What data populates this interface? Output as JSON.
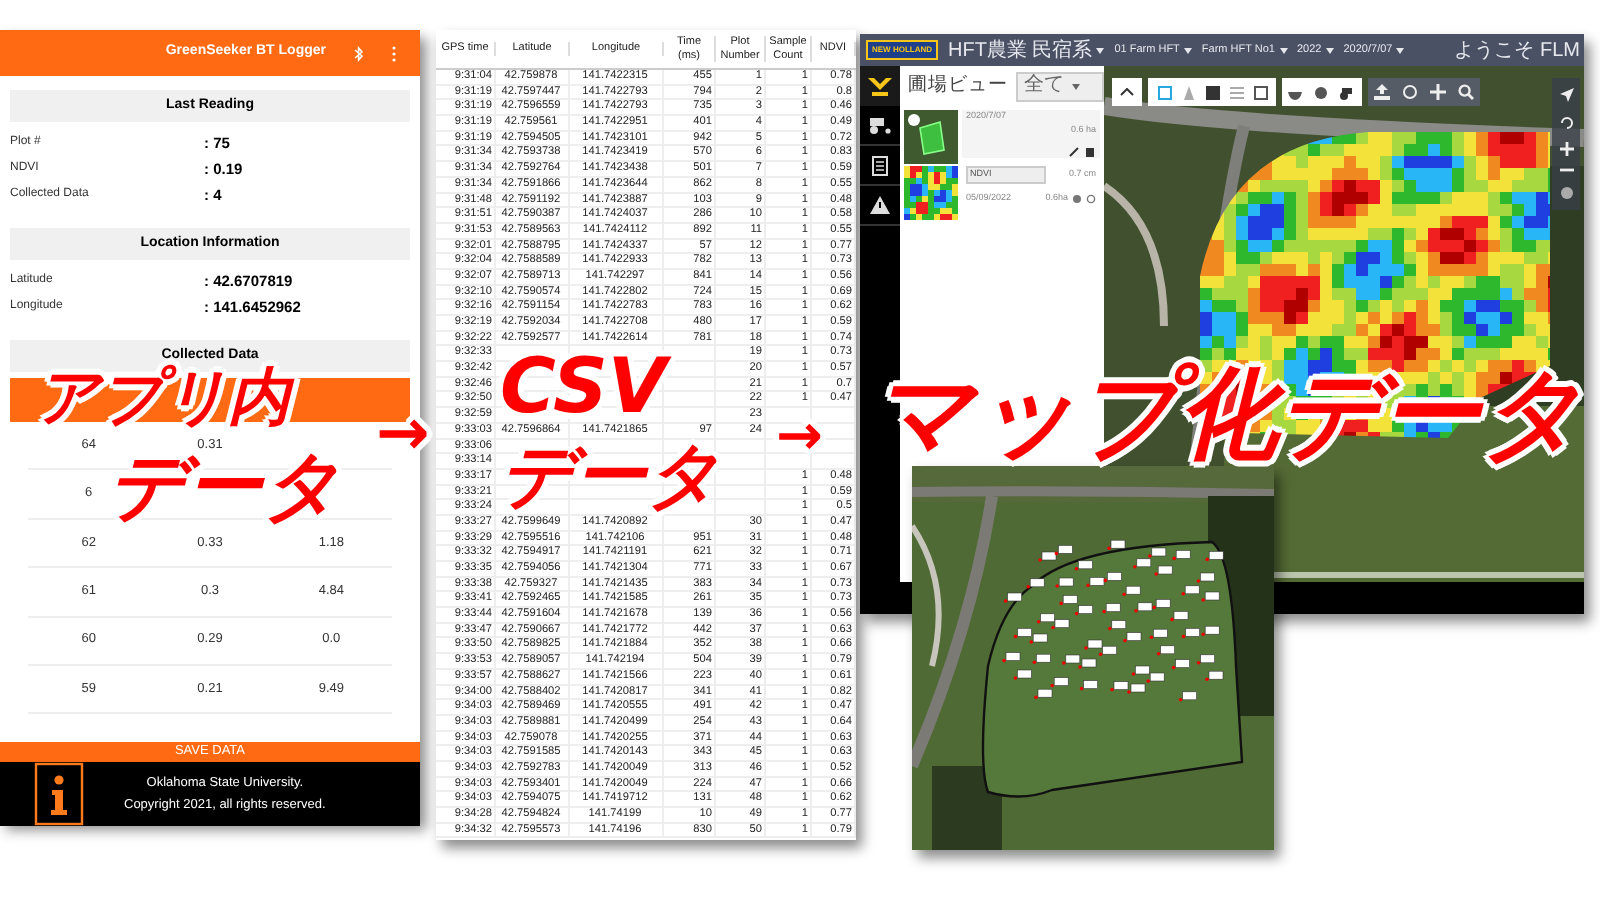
{
  "phone_app": {
    "title": "GreenSeeker BT Logger",
    "sections": [
      {
        "heading": "Last Reading",
        "fields": [
          {
            "label": "Plot #",
            "value": ": 75"
          },
          {
            "label": "NDVI",
            "value": ": 0.19"
          },
          {
            "label": "Collected Data",
            "value": ": 4"
          }
        ]
      },
      {
        "heading": "Location Information",
        "fields": [
          {
            "label": "Latitude",
            "value": ": 42.6707819"
          },
          {
            "label": "Longitude",
            "value": ": 141.6452962"
          }
        ]
      }
    ],
    "collected_data": {
      "heading": "Collected Data",
      "rows": [
        [
          "64",
          "0.31",
          null
        ],
        [
          "6",
          null,
          null
        ],
        [
          "62",
          "0.33",
          "1.18"
        ],
        [
          "61",
          "0.3",
          "4.84"
        ],
        [
          "60",
          "0.29",
          "0.0"
        ],
        [
          "59",
          "0.21",
          "9.49"
        ]
      ]
    },
    "save_button": "SAVE DATA",
    "footer_lines": [
      "Oklahoma State University.",
      "Copyright 2021, all rights reserved."
    ]
  },
  "csv_table": {
    "columns": [
      "GPS time",
      "Latitude",
      "Longitude",
      "Time (ms)",
      "Plot Number",
      "Sample Count",
      "NDVI"
    ],
    "rows": [
      [
        "9:31:04",
        "42.759878",
        "141.7422315",
        "455",
        "1",
        "1",
        "0.78"
      ],
      [
        "9:31:19",
        "42.7597447",
        "141.7422793",
        "794",
        "2",
        "1",
        "0.8"
      ],
      [
        "9:31:19",
        "42.7596559",
        "141.7422793",
        "735",
        "3",
        "1",
        "0.46"
      ],
      [
        "9:31:19",
        "42.759561",
        "141.7422951",
        "401",
        "4",
        "1",
        "0.49"
      ],
      [
        "9:31:19",
        "42.7594505",
        "141.7423101",
        "942",
        "5",
        "1",
        "0.72"
      ],
      [
        "9:31:34",
        "42.7593738",
        "141.7423419",
        "570",
        "6",
        "1",
        "0.83"
      ],
      [
        "9:31:34",
        "42.7592764",
        "141.7423438",
        "501",
        "7",
        "1",
        "0.59"
      ],
      [
        "9:31:34",
        "42.7591866",
        "141.7423644",
        "862",
        "8",
        "1",
        "0.55"
      ],
      [
        "9:31:48",
        "42.7591192",
        "141.7423887",
        "103",
        "9",
        "1",
        "0.48"
      ],
      [
        "9:31:51",
        "42.7590387",
        "141.7424037",
        "286",
        "10",
        "1",
        "0.58"
      ],
      [
        "9:31:53",
        "42.7589563",
        "141.7424112",
        "892",
        "11",
        "1",
        "0.55"
      ],
      [
        "9:32:01",
        "42.7588795",
        "141.7424337",
        "57",
        "12",
        "1",
        "0.77"
      ],
      [
        "9:32:04",
        "42.7588589",
        "141.7422933",
        "782",
        "13",
        "1",
        "0.73"
      ],
      [
        "9:32:07",
        "42.7589713",
        "141.742297",
        "841",
        "14",
        "1",
        "0.56"
      ],
      [
        "9:32:10",
        "42.7590574",
        "141.7422802",
        "724",
        "15",
        "1",
        "0.69"
      ],
      [
        "9:32:16",
        "42.7591154",
        "141.7422783",
        "783",
        "16",
        "1",
        "0.62"
      ],
      [
        "9:32:19",
        "42.7592034",
        "141.7422708",
        "480",
        "17",
        "1",
        "0.59"
      ],
      [
        "9:32:22",
        "42.7592577",
        "141.7422614",
        "781",
        "18",
        "1",
        "0.74"
      ],
      [
        "9:32:33",
        null,
        null,
        null,
        "19",
        "1",
        "0.73"
      ],
      [
        "9:32:42",
        null,
        null,
        null,
        "20",
        "1",
        "0.57"
      ],
      [
        "9:32:46",
        null,
        null,
        null,
        "21",
        "1",
        "0.7"
      ],
      [
        "9:32:50",
        null,
        null,
        null,
        "22",
        "1",
        "0.47"
      ],
      [
        "9:32:59",
        null,
        null,
        null,
        "23",
        null,
        null
      ],
      [
        "9:33:03",
        "42.7596864",
        "141.7421865",
        "97",
        "24",
        null,
        null
      ],
      [
        "9:33:06",
        null,
        null,
        null,
        null,
        null,
        null
      ],
      [
        "9:33:14",
        null,
        null,
        null,
        null,
        null,
        null
      ],
      [
        "9:33:17",
        null,
        null,
        null,
        null,
        "1",
        "0.48"
      ],
      [
        "9:33:21",
        null,
        null,
        null,
        null,
        "1",
        "0.59"
      ],
      [
        "9:33:24",
        null,
        null,
        null,
        null,
        "1",
        "0.5"
      ],
      [
        "9:33:27",
        "42.7599649",
        "141.7420892",
        null,
        "30",
        "1",
        "0.47"
      ],
      [
        "9:33:29",
        "42.7595516",
        "141.742106",
        "951",
        "31",
        "1",
        "0.48"
      ],
      [
        "9:33:32",
        "42.7594917",
        "141.7421191",
        "621",
        "32",
        "1",
        "0.71"
      ],
      [
        "9:33:35",
        "42.7594056",
        "141.7421304",
        "771",
        "33",
        "1",
        "0.67"
      ],
      [
        "9:33:38",
        "42.759327",
        "141.7421435",
        "383",
        "34",
        "1",
        "0.73"
      ],
      [
        "9:33:41",
        "42.7592465",
        "141.7421585",
        "261",
        "35",
        "1",
        "0.73"
      ],
      [
        "9:33:44",
        "42.7591604",
        "141.7421678",
        "139",
        "36",
        "1",
        "0.56"
      ],
      [
        "9:33:47",
        "42.7590667",
        "141.7421772",
        "442",
        "37",
        "1",
        "0.63"
      ],
      [
        "9:33:50",
        "42.7589825",
        "141.7421884",
        "352",
        "38",
        "1",
        "0.66"
      ],
      [
        "9:33:53",
        "42.7589057",
        "141.742194",
        "504",
        "39",
        "1",
        "0.79"
      ],
      [
        "9:33:57",
        "42.7588627",
        "141.7421566",
        "223",
        "40",
        "1",
        "0.61"
      ],
      [
        "9:34:00",
        "42.7588402",
        "141.7420817",
        "341",
        "41",
        "1",
        "0.82"
      ],
      [
        "9:34:03",
        "42.7589469",
        "141.7420555",
        "491",
        "42",
        "1",
        "0.47"
      ],
      [
        "9:34:03",
        "42.7589881",
        "141.7420499",
        "254",
        "43",
        "1",
        "0.64"
      ],
      [
        "9:34:03",
        "42.759078",
        "141.7420255",
        "371",
        "44",
        "1",
        "0.63"
      ],
      [
        "9:34:03",
        "42.7591585",
        "141.7420143",
        "343",
        "45",
        "1",
        "0.63"
      ],
      [
        "9:34:03",
        "42.7592783",
        "141.7420049",
        "313",
        "46",
        "1",
        "0.52"
      ],
      [
        "9:34:03",
        "42.7593401",
        "141.7420049",
        "224",
        "47",
        "1",
        "0.66"
      ],
      [
        "9:34:03",
        "42.7594075",
        "141.7419712",
        "131",
        "48",
        "1",
        "0.62"
      ],
      [
        "9:34:28",
        "42.7594824",
        "141.74199",
        "10",
        "49",
        "1",
        "0.77"
      ],
      [
        "9:34:32",
        "42.7595573",
        "141.74196",
        "830",
        "50",
        "1",
        "0.79"
      ]
    ]
  },
  "map_app": {
    "logo": "NEW HOLLAND",
    "selectors": [
      "HFT農業 民宿系",
      "01 Farm HFT",
      "Farm HFT No1",
      "2022",
      "2020/7/07"
    ],
    "user": "ようこそ FLM",
    "panel": {
      "title": "圃場ビュー",
      "filter": "全て",
      "cards": [
        {
          "kind": "field",
          "date": "2020/7/07",
          "area": "0.6 ha"
        },
        {
          "kind": "layer",
          "layer": "NDVI",
          "depth": "0.7 cm",
          "date": "05/09/2022",
          "area": "0.6ha"
        }
      ]
    }
  },
  "overlay": [
    {
      "kind": "caption",
      "lines": [
        "アプリ内",
        "データ"
      ]
    },
    {
      "kind": "arrow",
      "text": "→"
    },
    {
      "kind": "caption",
      "lines": [
        "CSV",
        "データ"
      ]
    },
    {
      "kind": "arrow",
      "text": "→"
    },
    {
      "kind": "caption",
      "lines": [
        "マップ化データ"
      ]
    }
  ]
}
